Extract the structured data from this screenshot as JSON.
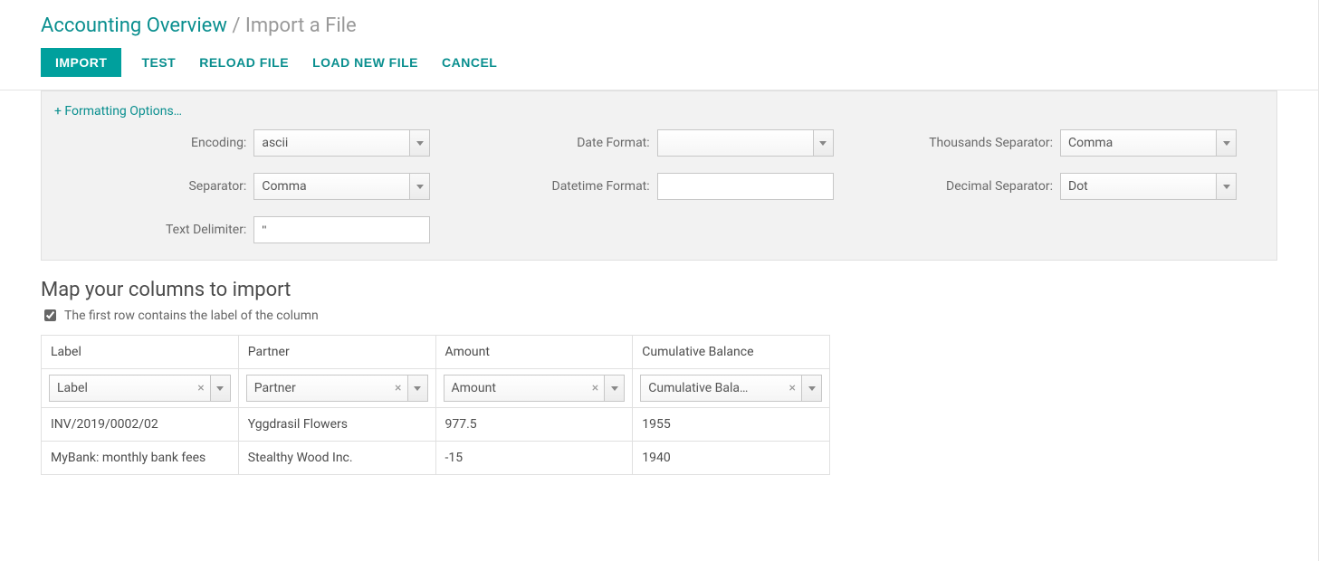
{
  "breadcrumb": {
    "parent": "Accounting Overview",
    "separator": "/",
    "current": "Import a File"
  },
  "toolbar": {
    "import_label": "IMPORT",
    "test_label": "TEST",
    "reload_label": "RELOAD FILE",
    "load_new_label": "LOAD NEW FILE",
    "cancel_label": "CANCEL"
  },
  "formatting": {
    "toggle_label": "+ Formatting Options…",
    "encoding_label": "Encoding:",
    "encoding_value": "ascii",
    "separator_label": "Separator:",
    "separator_value": "Comma",
    "text_delimiter_label": "Text Delimiter:",
    "text_delimiter_value": "\"",
    "date_format_label": "Date Format:",
    "date_format_value": "",
    "datetime_format_label": "Datetime Format:",
    "datetime_format_value": "",
    "thousands_sep_label": "Thousands Separator:",
    "thousands_sep_value": "Comma",
    "decimal_sep_label": "Decimal Separator:",
    "decimal_sep_value": "Dot"
  },
  "mapping": {
    "title": "Map your columns to import",
    "first_row_label": "The first row contains the label of the column",
    "first_row_checked": true,
    "columns": [
      {
        "header": "Label",
        "field": "Label"
      },
      {
        "header": "Partner",
        "field": "Partner"
      },
      {
        "header": "Amount",
        "field": "Amount"
      },
      {
        "header": "Cumulative Balance",
        "field": "Cumulative Bala…"
      }
    ],
    "rows": [
      {
        "c0": "INV/2019/0002/02",
        "c1": "Yggdrasil Flowers",
        "c2": "977.5",
        "c3": "1955"
      },
      {
        "c0": "MyBank: monthly bank fees",
        "c1": "Stealthy Wood Inc.",
        "c2": "-15",
        "c3": "1940"
      }
    ]
  }
}
